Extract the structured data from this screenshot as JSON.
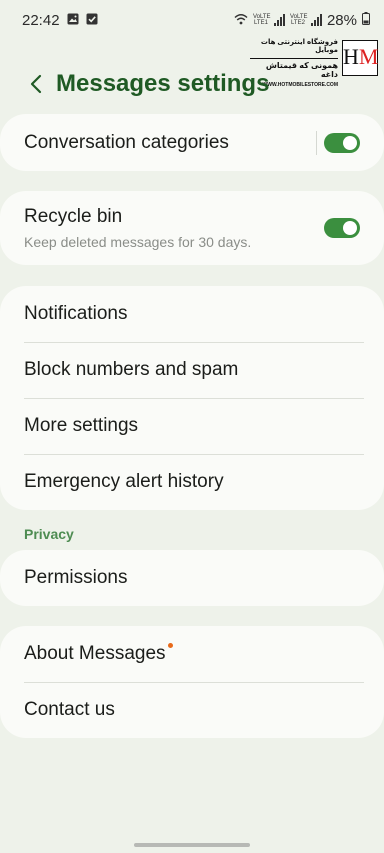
{
  "status_bar": {
    "time": "22:42",
    "sim1": "VoLTE LTE1",
    "sim2": "VoLTE LTE2",
    "battery": "28%"
  },
  "watermark": {
    "line1": "فروشگاه اینترنتی هات موبایل",
    "line2": "همونی که قیمتاش داغه",
    "line3": "WWW.HOTMOBILESTORE.COM",
    "logo_h": "H",
    "logo_m": "M"
  },
  "header": {
    "title": "Messages settings"
  },
  "card1": {
    "conversation_categories": {
      "label": "Conversation categories",
      "enabled": true
    }
  },
  "card2": {
    "recycle_bin": {
      "label": "Recycle bin",
      "sub": "Keep deleted messages for 30 days.",
      "enabled": true
    }
  },
  "card3": {
    "items": [
      {
        "label": "Notifications"
      },
      {
        "label": "Block numbers and spam"
      },
      {
        "label": "More settings"
      },
      {
        "label": "Emergency alert history"
      }
    ]
  },
  "privacy": {
    "section_label": "Privacy",
    "permissions": "Permissions"
  },
  "card5": {
    "about": "About Messages",
    "contact": "Contact us"
  },
  "colors": {
    "background": "#eef2ea",
    "card": "#fafbf8",
    "accent": "#3b8f3f",
    "title": "#1f5a24",
    "badge": "#e86a1a"
  }
}
